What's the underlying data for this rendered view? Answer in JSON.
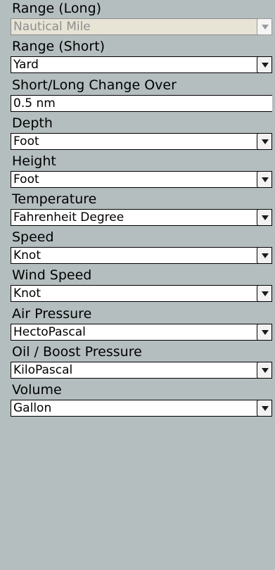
{
  "fields": [
    {
      "label": "Range (Long)",
      "value": "Nautical Mile",
      "type": "select",
      "disabled": true,
      "icon": "chevron-down-icon"
    },
    {
      "label": "Range (Short)",
      "value": "Yard",
      "type": "select",
      "icon": "chevron-down-icon"
    },
    {
      "label": "Short/Long Change Over",
      "value": "0.5 nm",
      "type": "text"
    },
    {
      "label": "Depth",
      "value": "Foot",
      "type": "select",
      "icon": "chevron-down-icon"
    },
    {
      "label": "Height",
      "value": "Foot",
      "type": "select",
      "icon": "chevron-down-icon"
    },
    {
      "label": "Temperature",
      "value": "Fahrenheit Degree",
      "type": "select",
      "icon": "chevron-down-icon"
    },
    {
      "label": "Speed",
      "value": "Knot",
      "type": "select",
      "icon": "chevron-down-icon"
    },
    {
      "label": "Wind Speed",
      "value": "Knot",
      "type": "select",
      "icon": "chevron-down-icon"
    },
    {
      "label": "Air Pressure",
      "value": "HectoPascal",
      "type": "select",
      "icon": "chevron-down-icon"
    },
    {
      "label": "Oil / Boost Pressure",
      "value": "KiloPascal",
      "type": "select",
      "icon": "chevron-down-icon"
    },
    {
      "label": "Volume",
      "value": "Gallon",
      "type": "select",
      "icon": "chevron-down-icon"
    }
  ],
  "colors": {
    "background": "#b5bebf",
    "control_background": "#ffffff",
    "disabled_background": "#e7e4d6",
    "disabled_text": "#8e8e8e"
  }
}
